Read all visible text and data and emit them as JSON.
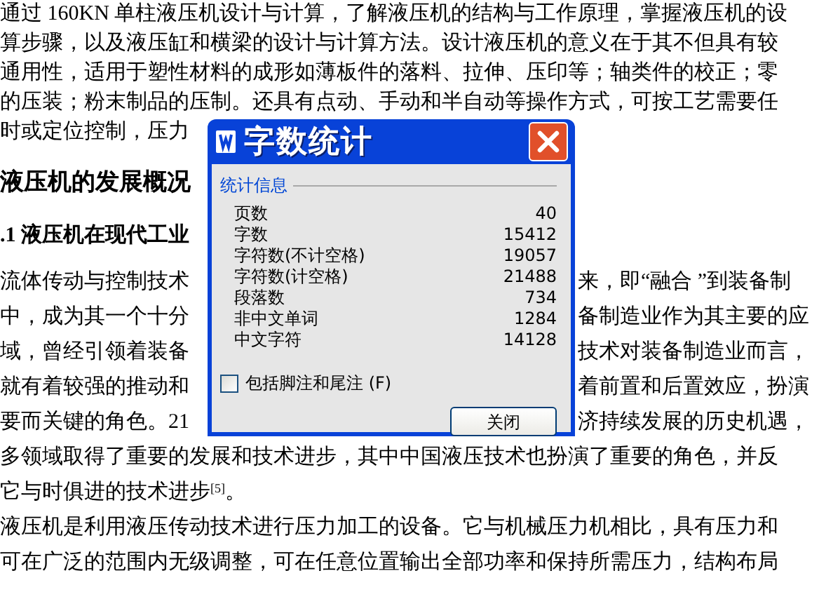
{
  "document": {
    "lines": [
      {
        "kind": "text",
        "left": "通过 160KN 单柱液压机设计与计算，了解液压机的结构与工作原理，掌握液压机的设"
      },
      {
        "kind": "text",
        "left": "算步骤，以及液压缸和横梁的设计与计算方法。设计液压机的意义在于其不但具有较"
      },
      {
        "kind": "text",
        "left": "通用性，适用于塑性材料的成形如薄板件的落料、拉伸、压印等；轴类件的校正；零"
      },
      {
        "kind": "text",
        "left": "的压装；粉末制品的压制。还具有点动、手动和半自动等操作方式，可按工艺需要任"
      },
      {
        "kind": "text",
        "left": "时或定位控制，压力"
      },
      {
        "kind": "heading",
        "left": "液压机的发展概况"
      },
      {
        "kind": "subheading",
        "left": ".1  液压机在现代工业"
      },
      {
        "kind": "text",
        "left": "流体传动与控制技术",
        "right": "来，即“融合 ”到装备制"
      },
      {
        "kind": "text",
        "left": "中，成为其一个十分",
        "right": "备制造业作为其主要的应"
      },
      {
        "kind": "text",
        "left": "域，曾经引领着装备",
        "right": "技术对装备制造业而言，"
      },
      {
        "kind": "text",
        "left": "就有着较强的推动和",
        "right": "着前置和后置效应，扮演"
      },
      {
        "kind": "text",
        "left": "要而关键的角色。21",
        "right": "济持续发展的历史机遇，"
      },
      {
        "kind": "text",
        "left": "多领域取得了重要的发展和技术进步，其中中国液压技术也扮演了重要的角色，并反"
      },
      {
        "kind": "text",
        "left": "它与时俱进的技术进步$^{[5]}$。"
      },
      {
        "kind": "text",
        "left": "液压机是利用液压传动技术进行压力加工的设备。它与机械压力机相比，具有压力和"
      },
      {
        "kind": "text",
        "left": "可在广泛的范围内无级调整，可在任意位置输出全部功率和保持所需压力，结构布局"
      }
    ]
  },
  "dialog": {
    "title": "字数统计",
    "group": "统计信息",
    "stats": [
      {
        "label": "页数",
        "value": "40"
      },
      {
        "label": "字数",
        "value": "15412"
      },
      {
        "label": "字符数(不计空格)",
        "value": "19057"
      },
      {
        "label": "字符数(计空格)",
        "value": "21488"
      },
      {
        "label": "段落数",
        "value": "734"
      },
      {
        "label": "非中文单词",
        "value": "1284"
      },
      {
        "label": "中文字符",
        "value": "14128"
      }
    ],
    "checkbox": {
      "label": "包括脚注和尾注",
      "shortcut": "(F)",
      "checked": false
    },
    "button": "关闭"
  }
}
